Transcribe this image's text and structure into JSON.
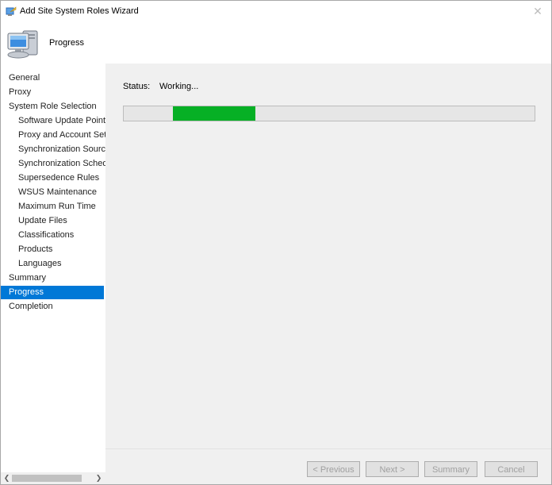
{
  "window": {
    "title": "Add Site System Roles Wizard",
    "close_glyph": "✕"
  },
  "header": {
    "title": "Progress"
  },
  "nav": {
    "items": [
      {
        "label": "General",
        "level": 0
      },
      {
        "label": "Proxy",
        "level": 0
      },
      {
        "label": "System Role Selection",
        "level": 0
      },
      {
        "label": "Software Update Point",
        "level": 1
      },
      {
        "label": "Proxy and Account Settings",
        "level": 1
      },
      {
        "label": "Synchronization Source",
        "level": 1
      },
      {
        "label": "Synchronization Schedule",
        "level": 1
      },
      {
        "label": "Supersedence Rules",
        "level": 1
      },
      {
        "label": "WSUS Maintenance",
        "level": 1
      },
      {
        "label": "Maximum Run Time",
        "level": 1
      },
      {
        "label": "Update Files",
        "level": 1
      },
      {
        "label": "Classifications",
        "level": 1
      },
      {
        "label": "Products",
        "level": 1
      },
      {
        "label": "Languages",
        "level": 1
      },
      {
        "label": "Summary",
        "level": 0
      },
      {
        "label": "Progress",
        "level": 0,
        "active": true
      },
      {
        "label": "Completion",
        "level": 0
      }
    ]
  },
  "main": {
    "status_label": "Status:",
    "status_value": "Working...",
    "progress": {
      "color": "#06b025"
    }
  },
  "buttons": {
    "previous": "< Previous",
    "next": "Next >",
    "summary": "Summary",
    "cancel": "Cancel"
  },
  "colors": {
    "accent": "#0078d7",
    "progress_fill": "#06b025"
  }
}
